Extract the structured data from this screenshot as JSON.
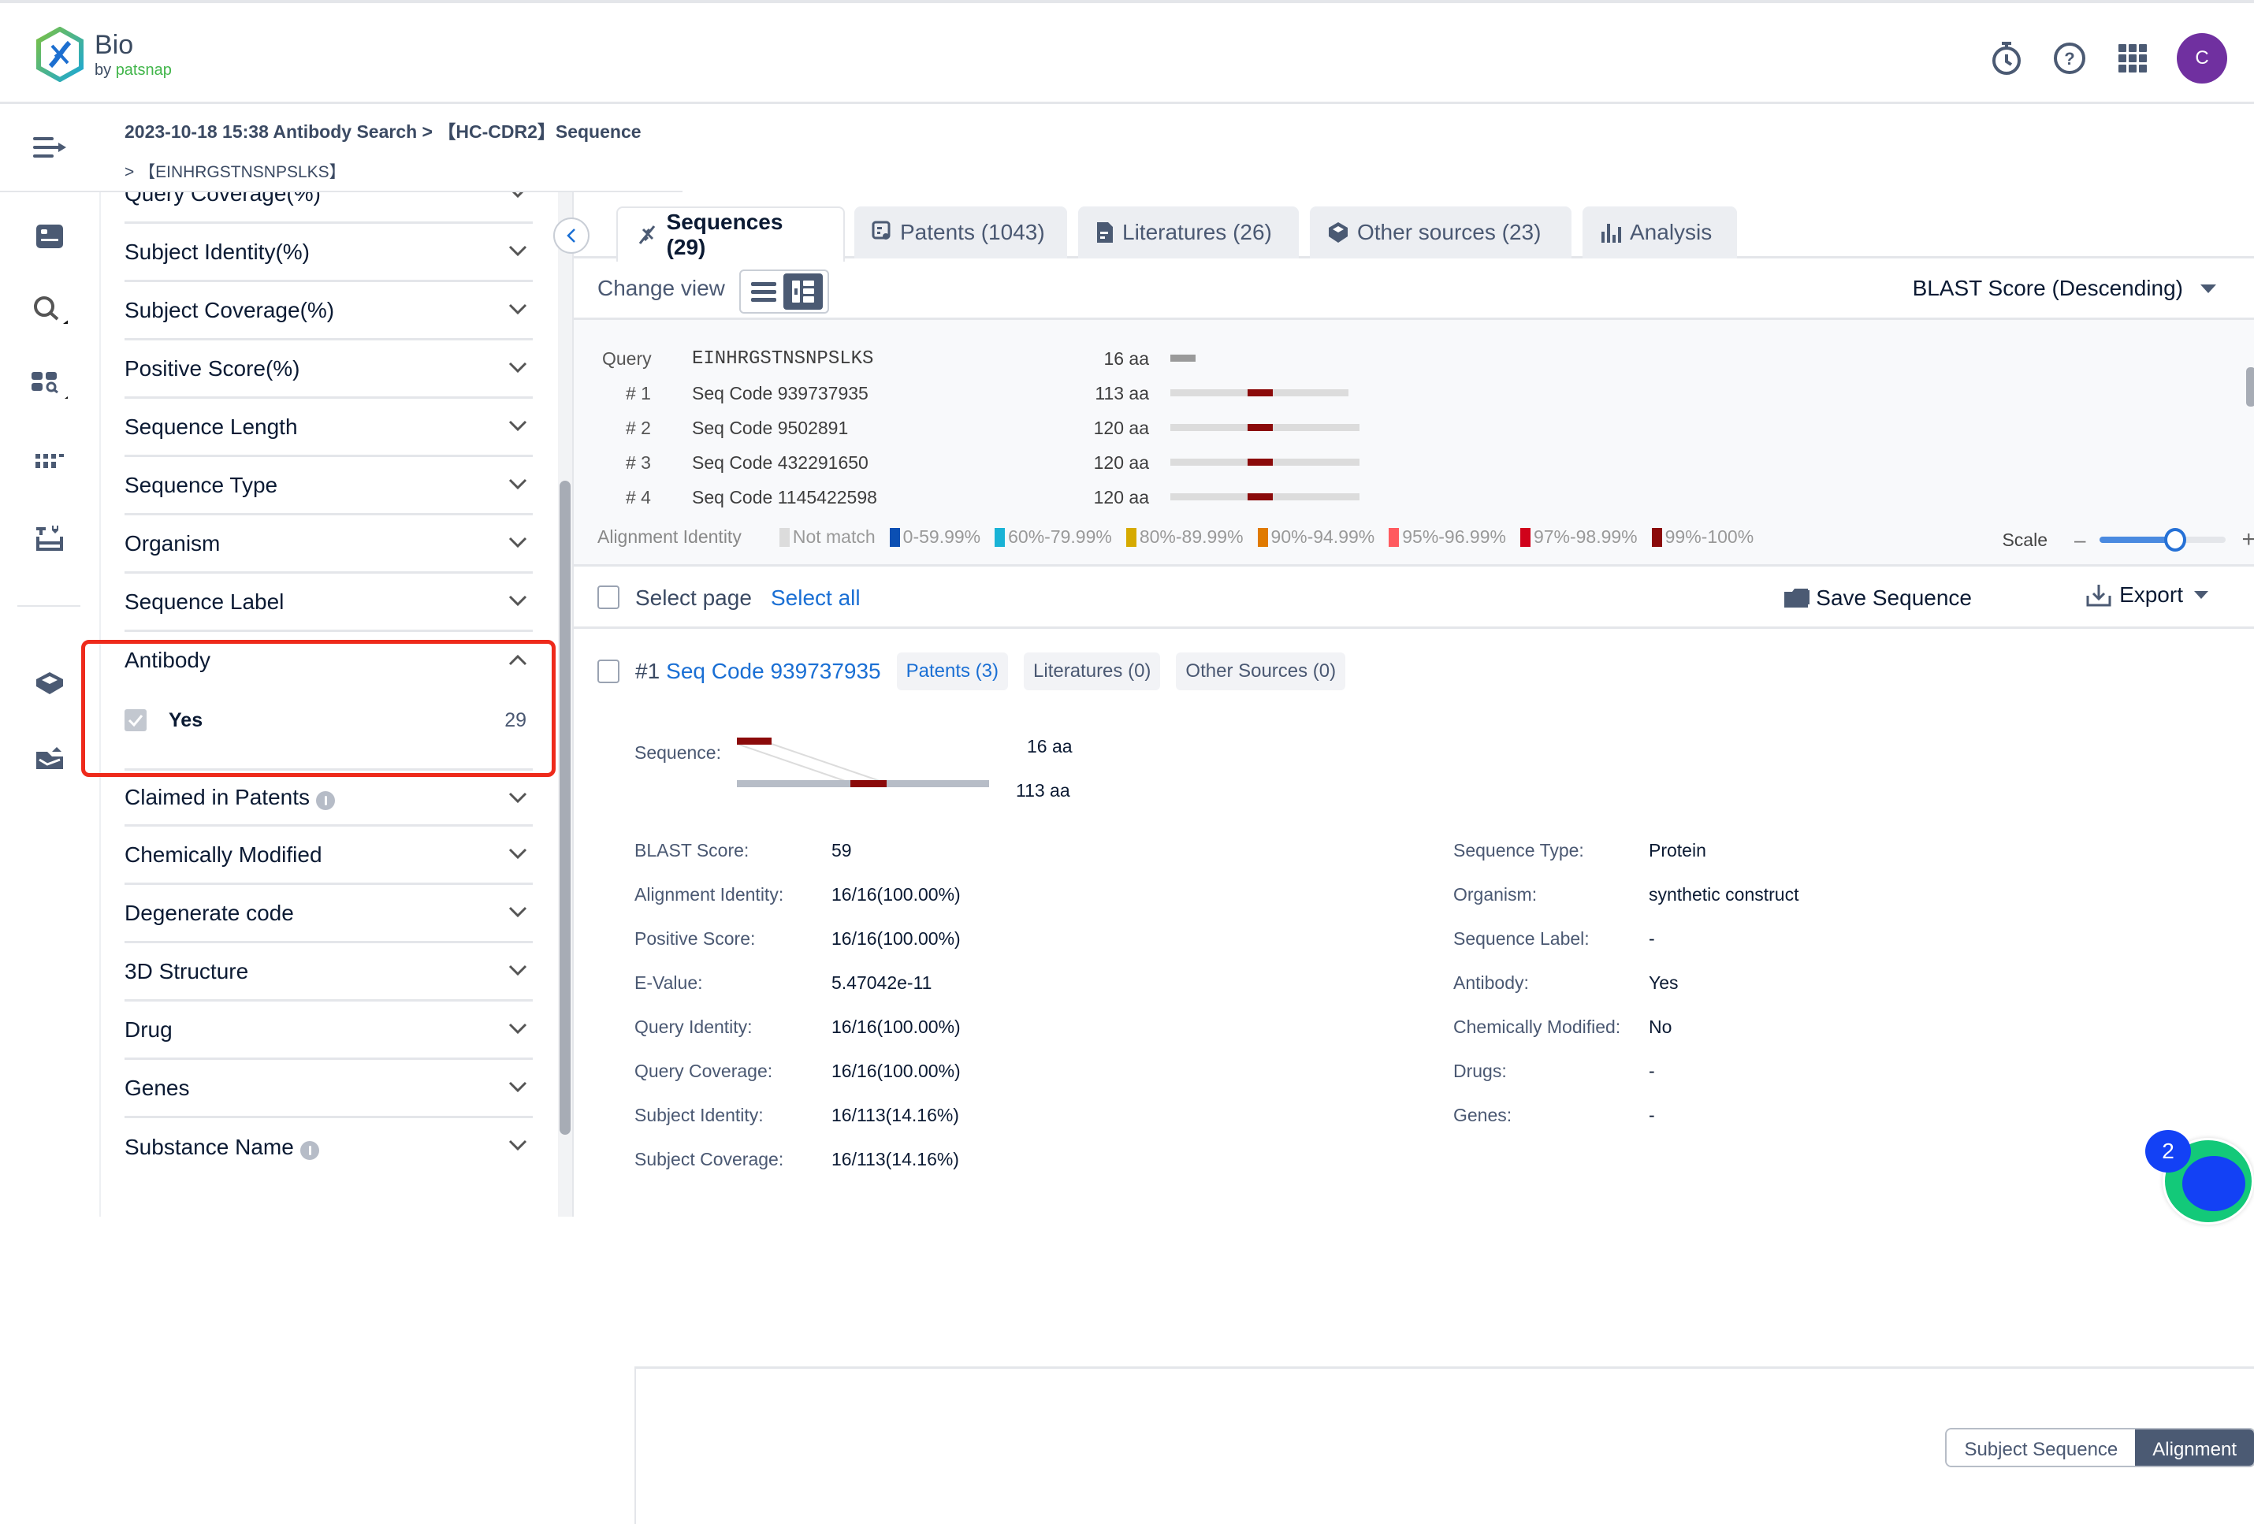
{
  "app": {
    "title": "Bio",
    "subtitle_prefix": "by ",
    "subtitle_brand": "patsnap"
  },
  "topbar": {
    "icons": [
      "timer-icon",
      "help-icon",
      "apps-grid-icon"
    ],
    "avatar_letter": "C",
    "avatar_color": "#7030a0"
  },
  "leftnav": {
    "items": [
      "collapse-menu-icon",
      "saved-icon",
      "search-icon",
      "sequence-search-icon",
      "grid-icon",
      "toolbox-icon",
      "workspace-icon",
      "alerts-icon"
    ]
  },
  "breadcrumb": {
    "line1": "2023-10-18 15:38 Antibody Search > 【HC-CDR2】Sequence",
    "line2": "> 【EINHRGSTNSNPSLKS】"
  },
  "filters": {
    "items_top": [
      "Query Coverage(%)",
      "Subject Identity(%)",
      "Subject Coverage(%)",
      "Positive Score(%)",
      "Sequence Length",
      "Sequence Type",
      "Organism",
      "Sequence Label"
    ],
    "antibody": {
      "label": "Antibody",
      "options": [
        {
          "label": "Yes",
          "count": "29",
          "checked": true
        }
      ]
    },
    "items_bottom": [
      {
        "label": "Claimed in Patents",
        "info": true
      },
      {
        "label": "Chemically Modified",
        "info": false
      },
      {
        "label": "Degenerate code",
        "info": false
      },
      {
        "label": "3D Structure",
        "info": false
      },
      {
        "label": "Drug",
        "info": false
      },
      {
        "label": "Genes",
        "info": false
      },
      {
        "label": "Substance Name",
        "info": true
      }
    ]
  },
  "tabs": [
    {
      "label": "Sequences (29)",
      "icon": "dna-icon",
      "active": true
    },
    {
      "label": "Patents (1043)",
      "icon": "patent-icon",
      "active": false
    },
    {
      "label": "Literatures (26)",
      "icon": "document-icon",
      "active": false
    },
    {
      "label": "Other sources (23)",
      "icon": "cube-icon",
      "active": false
    },
    {
      "label": "Analysis",
      "icon": "bar-chart-icon",
      "active": false
    }
  ],
  "view": {
    "label": "Change view",
    "sort": "BLAST Score (Descending)"
  },
  "overview": {
    "query": {
      "label": "Query",
      "sequence": "EINHRGSTNSNPSLKS",
      "length": "16 aa"
    },
    "hits": [
      {
        "rank": "# 1",
        "name": "Seq Code 939737935",
        "length": "113 aa",
        "len_aa": 113
      },
      {
        "rank": "# 2",
        "name": "Seq Code 9502891",
        "length": "120 aa",
        "len_aa": 120
      },
      {
        "rank": "# 3",
        "name": "Seq Code 432291650",
        "length": "120 aa",
        "len_aa": 120
      },
      {
        "rank": "# 4",
        "name": "Seq Code 1145422598",
        "length": "120 aa",
        "len_aa": 120
      }
    ],
    "legend_title": "Alignment Identity",
    "legend": [
      {
        "label": "Not match",
        "color": "#dcdcdc"
      },
      {
        "label": "0-59.99%",
        "color": "#0b4fb3"
      },
      {
        "label": "60%-79.99%",
        "color": "#19b3d6"
      },
      {
        "label": "80%-89.99%",
        "color": "#d6aa00"
      },
      {
        "label": "90%-94.99%",
        "color": "#e07a00"
      },
      {
        "label": "95%-96.99%",
        "color": "#ff5a5f"
      },
      {
        "label": "97%-98.99%",
        "color": "#d0021b"
      },
      {
        "label": "99%-100%",
        "color": "#8b0a0a"
      }
    ],
    "scale_label": "Scale",
    "scale_value": 0.6
  },
  "selection": {
    "select_page": "Select page",
    "select_all": "Select all",
    "save": "Save Sequence",
    "export": "Export"
  },
  "result": {
    "num": "#1",
    "code": "Seq Code 939737935",
    "chips": [
      "Patents (3)",
      "Literatures (0)",
      "Other Sources (0)"
    ],
    "seq_label": "Sequence:",
    "query_len": "16 aa",
    "subject_len": "113 aa",
    "props_left": [
      {
        "k": "BLAST Score:",
        "v": "59"
      },
      {
        "k": "Alignment Identity:",
        "v": "16/16(100.00%)"
      },
      {
        "k": "Positive Score:",
        "v": "16/16(100.00%)"
      },
      {
        "k": "E-Value:",
        "v": "5.47042e-11"
      },
      {
        "k": "Query Identity:",
        "v": "16/16(100.00%)"
      },
      {
        "k": "Query Coverage:",
        "v": "16/16(100.00%)"
      },
      {
        "k": "Subject Identity:",
        "v": "16/113(14.16%)"
      },
      {
        "k": "Subject Coverage:",
        "v": "16/113(14.16%)"
      }
    ],
    "props_right": [
      {
        "k": "Sequence Type:",
        "v": "Protein"
      },
      {
        "k": "Organism:",
        "v": "synthetic construct"
      },
      {
        "k": "Sequence Label:",
        "v": "-"
      },
      {
        "k": "Antibody:",
        "v": "Yes"
      },
      {
        "k": "Chemically Modified:",
        "v": "No"
      },
      {
        "k": "Drugs:",
        "v": "-"
      },
      {
        "k": "Genes:",
        "v": "-"
      }
    ],
    "seg_buttons": [
      "Subject Sequence",
      "Alignment"
    ]
  },
  "assistant": {
    "badge": "2"
  }
}
